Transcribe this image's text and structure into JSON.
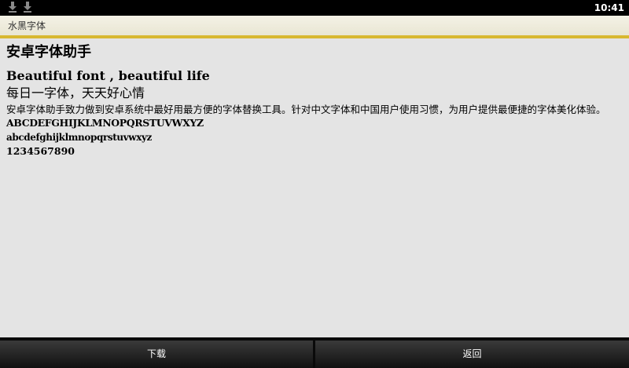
{
  "status_bar": {
    "time": "10:41",
    "notification_icons": [
      "download-icon",
      "download-icon"
    ]
  },
  "app": {
    "title": "水黑字体"
  },
  "content": {
    "heading": "安卓字体助手",
    "latin_title": "Beautiful font , beautiful life",
    "slogan": "每日一字体，天天好心情",
    "description": "安卓字体助手致力做到安卓系统中最好用最方便的字体替换工具。针对中文字体和中国用户使用习惯，为用户提供最便捷的字体美化体验。",
    "uppercase_sample": "ABCDEFGHIJKLMNOPQRSTUVWXYZ",
    "lowercase_sample": "abcdefghijklmnopqrstuvwxyz",
    "digits_sample": "1234567890"
  },
  "buttons": {
    "download": "下载",
    "back": "返回"
  },
  "colors": {
    "accent": "#d8b830",
    "status_bar": "#000000",
    "background": "#e4e4e4"
  }
}
